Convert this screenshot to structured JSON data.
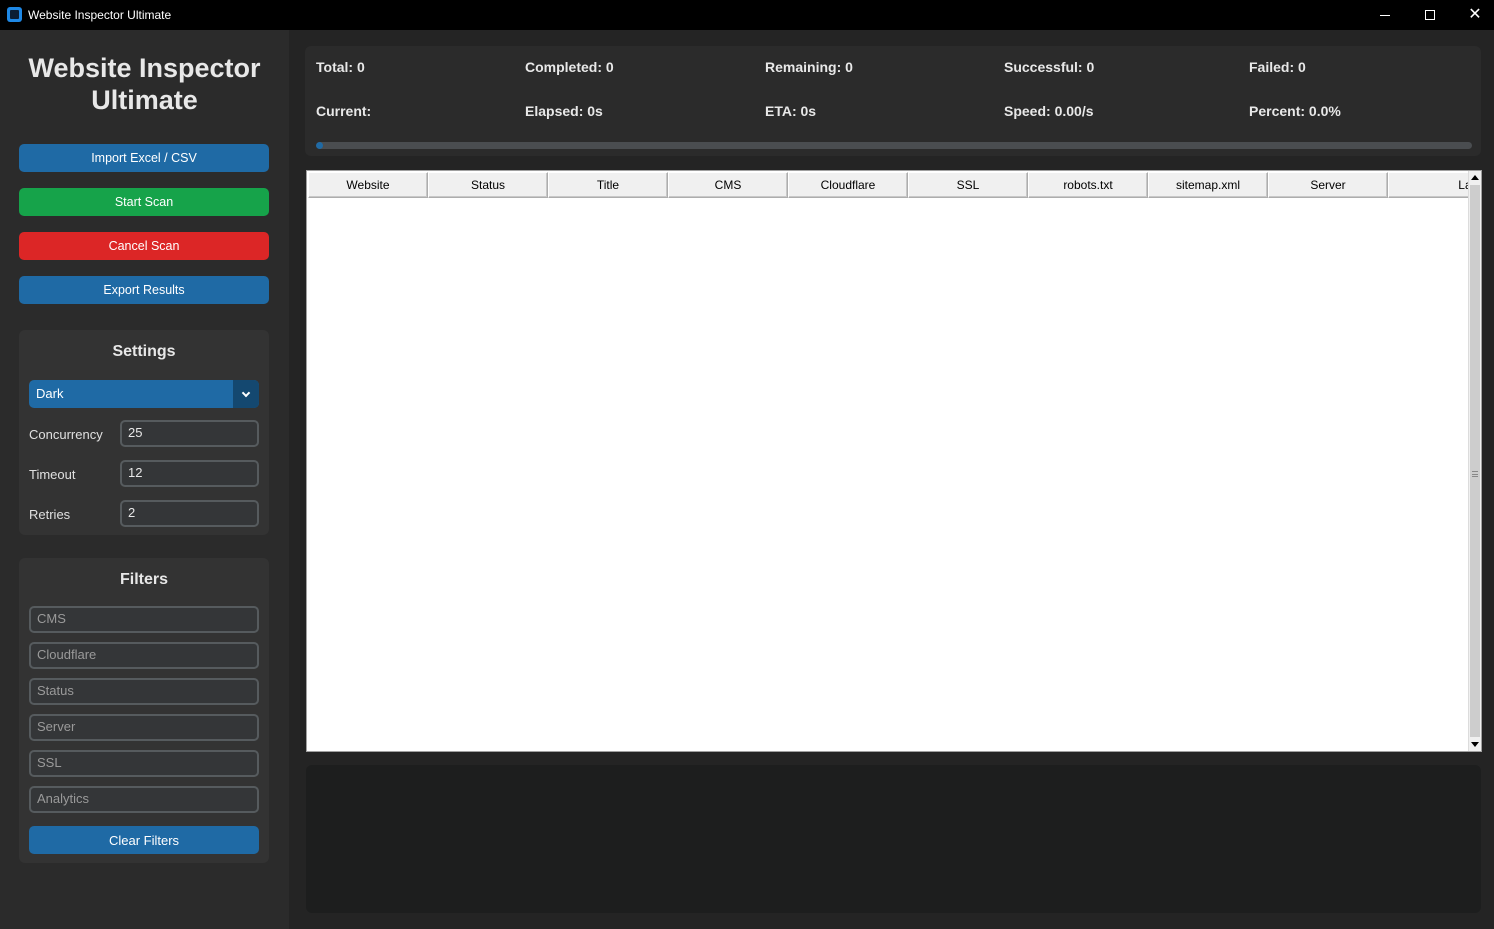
{
  "window": {
    "title": "Website Inspector Ultimate"
  },
  "sidebar": {
    "app_title": "Website Inspector Ultimate",
    "buttons": {
      "import": "Import Excel / CSV",
      "start": "Start Scan",
      "cancel": "Cancel Scan",
      "export": "Export Results"
    },
    "settings": {
      "title": "Settings",
      "theme": "Dark",
      "concurrency_label": "Concurrency",
      "concurrency_value": "25",
      "timeout_label": "Timeout",
      "timeout_value": "12",
      "retries_label": "Retries",
      "retries_value": "2"
    },
    "filters": {
      "title": "Filters",
      "placeholders": [
        "CMS",
        "Cloudflare",
        "Status",
        "Server",
        "SSL",
        "Analytics"
      ],
      "clear_label": "Clear Filters"
    }
  },
  "stats": {
    "total": "Total: 0",
    "completed": "Completed: 0",
    "remaining": "Remaining: 0",
    "successful": "Successful: 0",
    "failed": "Failed: 0",
    "current": "Current:",
    "elapsed": "Elapsed: 0s",
    "eta": "ETA: 0s",
    "speed": "Speed: 0.00/s",
    "percent": "Percent: 0.0%",
    "progress_fraction": 0.005
  },
  "table": {
    "columns": [
      "Website",
      "Status",
      "Title",
      "CMS",
      "Cloudflare",
      "SSL",
      "robots.txt",
      "sitemap.xml",
      "Server",
      "Languag"
    ],
    "rows": []
  },
  "colors": {
    "accent_blue": "#1f6aa5",
    "start_green": "#16a34a",
    "cancel_red": "#dc2626",
    "window_bg": "#242424",
    "panel_bg": "#2b2b2b"
  }
}
